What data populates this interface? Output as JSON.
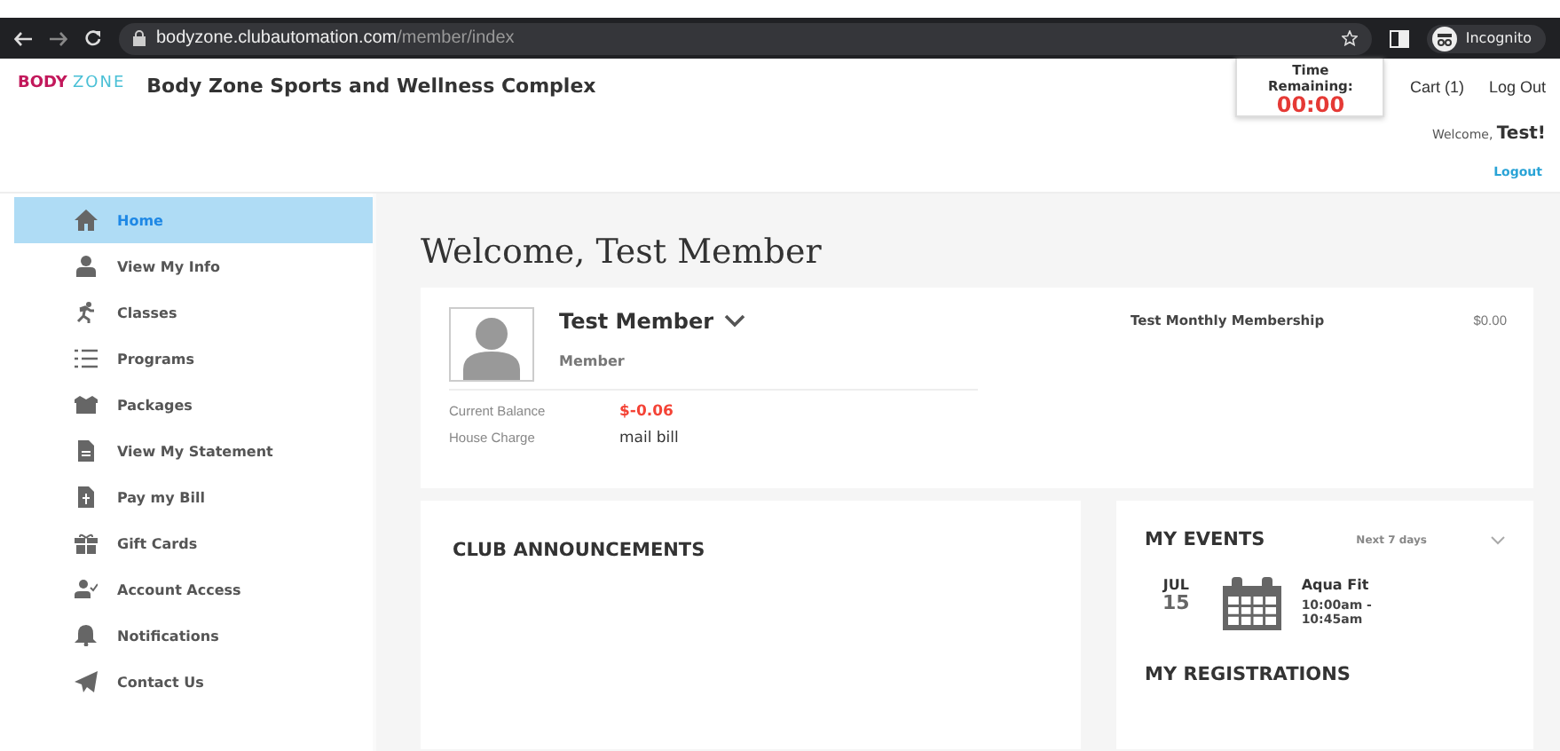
{
  "browser": {
    "url_domain": "bodyzone.clubautomation.com",
    "url_path": "/member/index",
    "profile": "Incognito"
  },
  "header": {
    "logo": {
      "brand": "BODY",
      "mark": "ZONE"
    },
    "title": "Body Zone Sports and Wellness Complex",
    "timer": {
      "label": "Time Remaining:",
      "value": "00:00"
    },
    "links": [
      "Cart (1)",
      "Log Out"
    ],
    "welcome": "Welcome,",
    "user": "Test!",
    "logout": "Logout"
  },
  "sidebar": {
    "items": [
      {
        "label": "Home",
        "selected": true
      },
      {
        "label": "View My Info",
        "selected": false
      },
      {
        "label": "Classes",
        "selected": false
      },
      {
        "label": "Programs",
        "selected": false
      },
      {
        "label": "Packages",
        "selected": false
      },
      {
        "label": "View My Statement",
        "selected": false
      },
      {
        "label": "Pay my Bill",
        "selected": false
      },
      {
        "label": "Gift Cards",
        "selected": false
      },
      {
        "label": "Account Access",
        "selected": false
      },
      {
        "label": "Notifications",
        "selected": false
      },
      {
        "label": "Contact Us",
        "selected": false
      }
    ]
  },
  "main": {
    "heading": "Welcome, Test Member",
    "member": {
      "name": "Test Member",
      "role": "Member",
      "fields": [
        {
          "label": "Current Balance",
          "value": "$-0.06",
          "negative": true
        },
        {
          "label": "House Charge",
          "value": "mail bill",
          "negative": false
        }
      ],
      "membership": {
        "name": "Test Monthly Membership",
        "price": "$0.00"
      }
    },
    "announcements": {
      "title": "CLUB ANNOUNCEMENTS"
    },
    "events": {
      "title": "MY EVENTS",
      "range": "Next 7 days",
      "items": [
        {
          "month": "JUL",
          "day": "15",
          "name": "Aqua Fit",
          "time": "10:00am -\n10:45am"
        }
      ]
    },
    "registrations": {
      "title": "MY REGISTRATIONS"
    }
  }
}
